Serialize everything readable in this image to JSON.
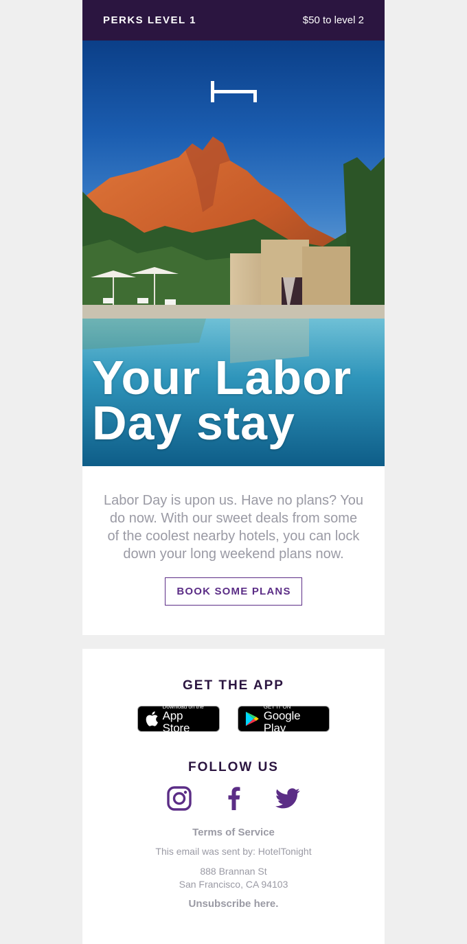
{
  "header": {
    "perks_level": "PERKS LEVEL 1",
    "progress_text": "$50 to level 2"
  },
  "hero": {
    "logo_icon": "hoteltonight-bed-logo-icon",
    "title_line1": "Your Labor",
    "title_line2": "Day stay"
  },
  "content": {
    "intro": "Labor Day is upon us. Have no plans? You do now. With our sweet deals from some of the coolest nearby hotels, you can lock down your long weekend plans now.",
    "cta_label": "BOOK SOME PLANS"
  },
  "footer": {
    "get_app_heading": "GET THE APP",
    "app_store": {
      "small": "Download on the",
      "big": "App Store"
    },
    "google_play": {
      "small": "GET IT ON",
      "big": "Google Play"
    },
    "follow_heading": "FOLLOW US",
    "social_icons": [
      "instagram-icon",
      "facebook-icon",
      "twitter-icon"
    ],
    "terms_label": "Terms of Service",
    "sent_by": "This email was sent by: HotelTonight",
    "address_line1": "888 Brannan St",
    "address_line2": "San Francisco, CA 94103",
    "unsubscribe_label": "Unsubscribe here."
  },
  "colors": {
    "brand_purple": "#2b1540",
    "accent_purple": "#5b2d86",
    "muted_text": "#9a9aa4",
    "page_bg": "#efefef"
  }
}
